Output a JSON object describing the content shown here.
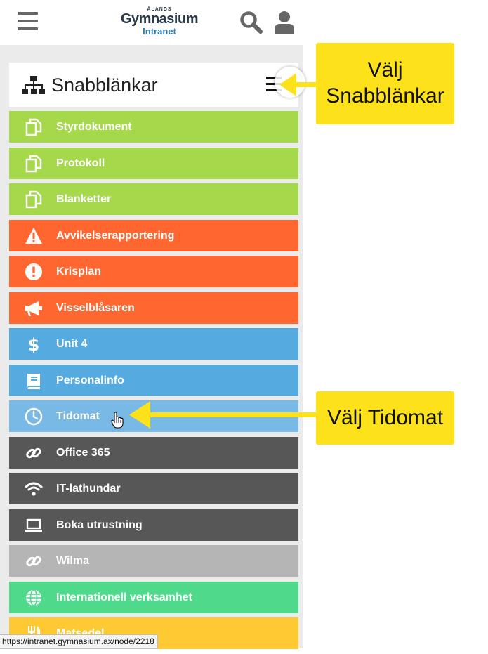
{
  "header": {
    "logo": {
      "top": "ÅLANDS",
      "main": "Gymnasium",
      "sub": "Intranet"
    },
    "menu_icon": "menu-icon",
    "search_icon": "search-icon",
    "user_icon": "user-icon"
  },
  "quicklinks": {
    "title": "Snabblänkar",
    "icon": "sitemap-icon",
    "toggle_icon": "menu-icon",
    "items": [
      {
        "label": "Styrdokument",
        "icon": "copy-icon",
        "color": "#a5d84b"
      },
      {
        "label": "Protokoll",
        "icon": "copy-icon",
        "color": "#a5d84b"
      },
      {
        "label": "Blanketter",
        "icon": "copy-icon",
        "color": "#a5d84b"
      },
      {
        "label": "Avvikelserapportering",
        "icon": "warning-icon",
        "color": "#ff6630"
      },
      {
        "label": "Krisplan",
        "icon": "exclamation-icon",
        "color": "#ff6630"
      },
      {
        "label": "Visselblåsaren",
        "icon": "megaphone-icon",
        "color": "#ff6630"
      },
      {
        "label": "Unit 4",
        "icon": "dollar-icon",
        "color": "#55aae0"
      },
      {
        "label": "Personalinfo",
        "icon": "book-icon",
        "color": "#55aae0"
      },
      {
        "label": "Tidomat",
        "icon": "clock-icon",
        "color": "#79b9e6"
      },
      {
        "label": "Office 365",
        "icon": "link-icon",
        "color": "#575757"
      },
      {
        "label": "IT-lathundar",
        "icon": "wifi-icon",
        "color": "#575757"
      },
      {
        "label": "Boka utrustning",
        "icon": "laptop-icon",
        "color": "#575757"
      },
      {
        "label": "Wilma",
        "icon": "link-icon",
        "color": "#b5b5b5"
      },
      {
        "label": "Internationell verksamhet",
        "icon": "globe-icon",
        "color": "#4fd98b"
      },
      {
        "label": "Matsedel",
        "icon": "utensils-icon",
        "color": "#ffc934"
      }
    ]
  },
  "annotations": {
    "callout_quicklinks": [
      "Välj",
      "Snabblänkar"
    ],
    "callout_tidomat": "Välj Tidomat",
    "arrow_color": "#fde21b"
  },
  "statusbar": {
    "url": "https://intranet.gymnasium.ax/node/2218"
  }
}
